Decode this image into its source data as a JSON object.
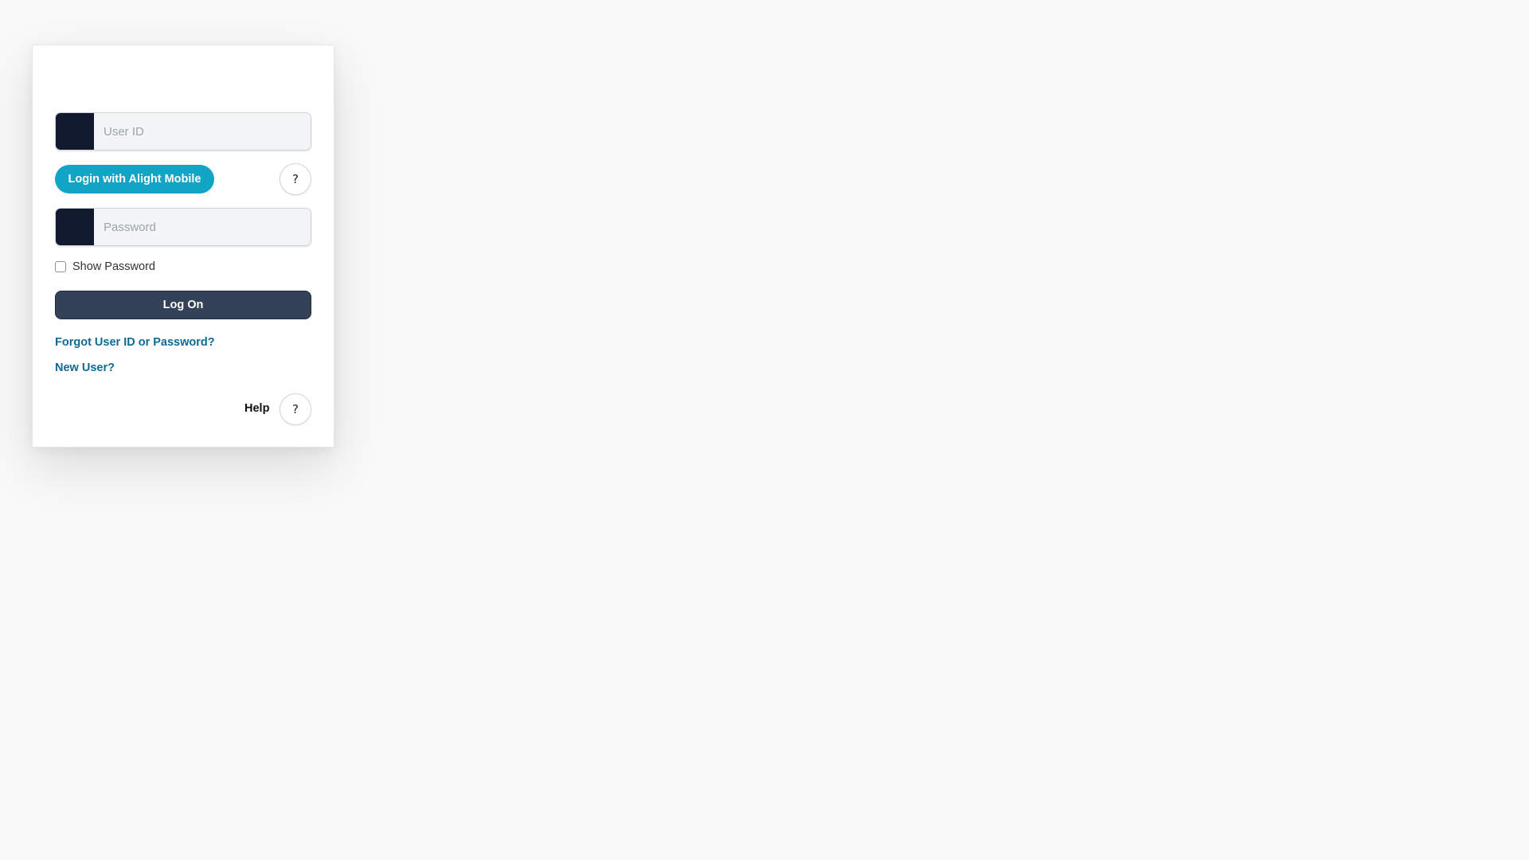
{
  "login": {
    "user_id": {
      "placeholder": "User ID",
      "value": ""
    },
    "mobile_login_label": "Login with Alight Mobile",
    "mobile_help_symbol": "?",
    "password": {
      "placeholder": "Password",
      "value": ""
    },
    "show_password_label": "Show Password",
    "show_password_checked": false,
    "logon_label": "Log On",
    "forgot_link": "Forgot User ID or Password?",
    "new_user_link": "New User?",
    "help_label": "Help",
    "help_symbol": "?"
  },
  "colors": {
    "page_background": "#f9f9f9",
    "input_icon_block": "#111a2e",
    "mobile_button": "#12a4c4",
    "logon_button": "#334256",
    "link": "#0e6a93"
  },
  "icons": {
    "user_field_icon": "user-icon",
    "password_field_icon": "lock-icon",
    "help_icon": "question-mark-icon"
  }
}
